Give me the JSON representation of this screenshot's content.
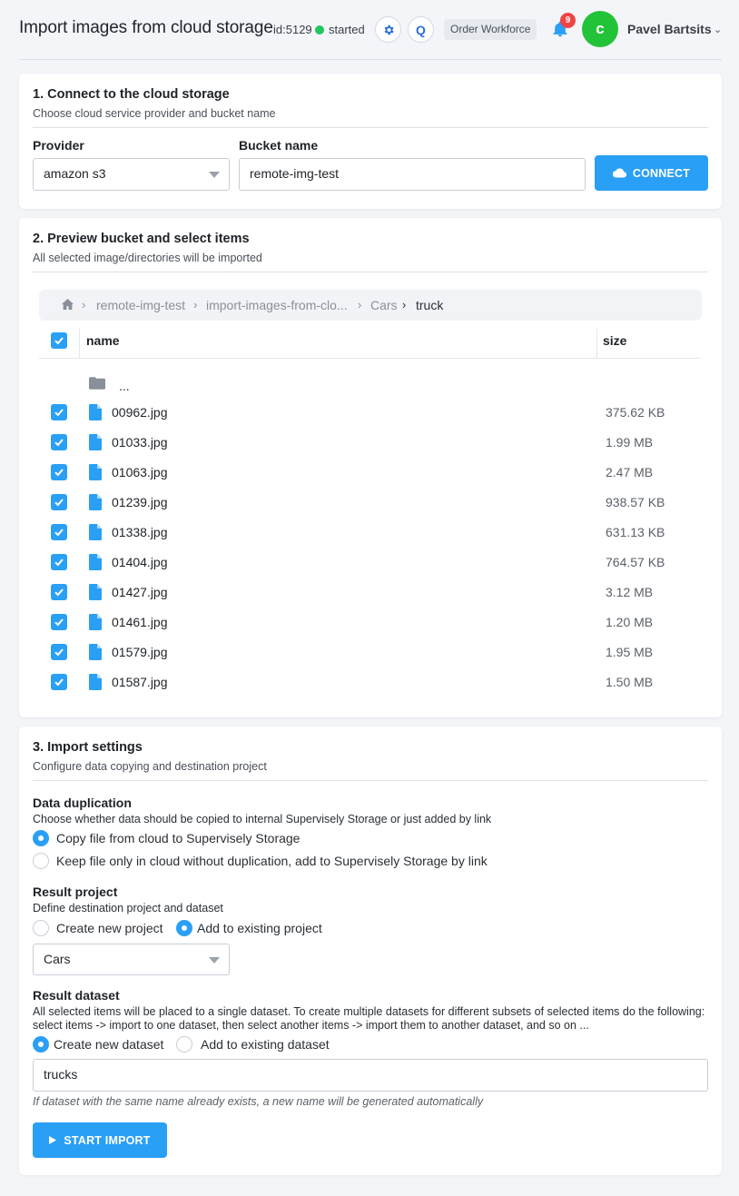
{
  "header": {
    "title": "Import images from cloud storage",
    "app_id": "id:5129",
    "status": "started",
    "q_label": "Q",
    "workforce_label": "Order Workforce",
    "notifications": "9",
    "avatar_letter": "c",
    "user_name": "Pavel Bartsits",
    "status_color": "#22c55e",
    "avatar_color": "#22c338"
  },
  "step1": {
    "title": "1. Connect to the cloud storage",
    "subtitle": "Choose cloud service provider and bucket name",
    "provider_label": "Provider",
    "provider_value": "amazon s3",
    "bucket_label": "Bucket name",
    "bucket_value": "remote-img-test",
    "connect_label": "CONNECT"
  },
  "step2": {
    "title": "2. Preview bucket and select items",
    "subtitle": "All selected image/directories will be imported",
    "breadcrumb": [
      "remote-img-test",
      "import-images-from-clo...",
      "Cars",
      "truck"
    ],
    "col_name": "name",
    "col_size": "size",
    "parent_dir": "...",
    "files": [
      {
        "name": "00962.jpg",
        "size": "375.62 KB"
      },
      {
        "name": "01033.jpg",
        "size": "1.99 MB"
      },
      {
        "name": "01063.jpg",
        "size": "2.47 MB"
      },
      {
        "name": "01239.jpg",
        "size": "938.57 KB"
      },
      {
        "name": "01338.jpg",
        "size": "631.13 KB"
      },
      {
        "name": "01404.jpg",
        "size": "764.57 KB"
      },
      {
        "name": "01427.jpg",
        "size": "3.12 MB"
      },
      {
        "name": "01461.jpg",
        "size": "1.20 MB"
      },
      {
        "name": "01579.jpg",
        "size": "1.95 MB"
      },
      {
        "name": "01587.jpg",
        "size": "1.50 MB"
      }
    ]
  },
  "step3": {
    "title": "3. Import settings",
    "subtitle": "Configure data copying and destination project",
    "dup_label": "Data duplication",
    "dup_desc": "Choose whether data should be copied to internal Supervisely Storage or just added by link",
    "dup_opt1": "Copy file from cloud to Supervisely Storage",
    "dup_opt2": "Keep file only in cloud without duplication, add to Supervisely Storage by link",
    "proj_label": "Result project",
    "proj_desc": "Define destination project and dataset",
    "proj_opt1": "Create new project",
    "proj_opt2": "Add to existing project",
    "proj_value": "Cars",
    "ds_label": "Result dataset",
    "ds_desc": "All selected items will be placed to a single dataset. To create multiple datasets for different subsets of selected items do the following: select items -> import to one dataset, then select another items -> import them to another dataset, and so on ...",
    "ds_opt1": "Create new dataset",
    "ds_opt2": "Add to existing dataset",
    "ds_value": "trucks",
    "ds_hint": "If dataset with the same name already exists, a new name will be generated automatically",
    "start_label": "START IMPORT"
  },
  "accent_color": "#2a9ff6"
}
